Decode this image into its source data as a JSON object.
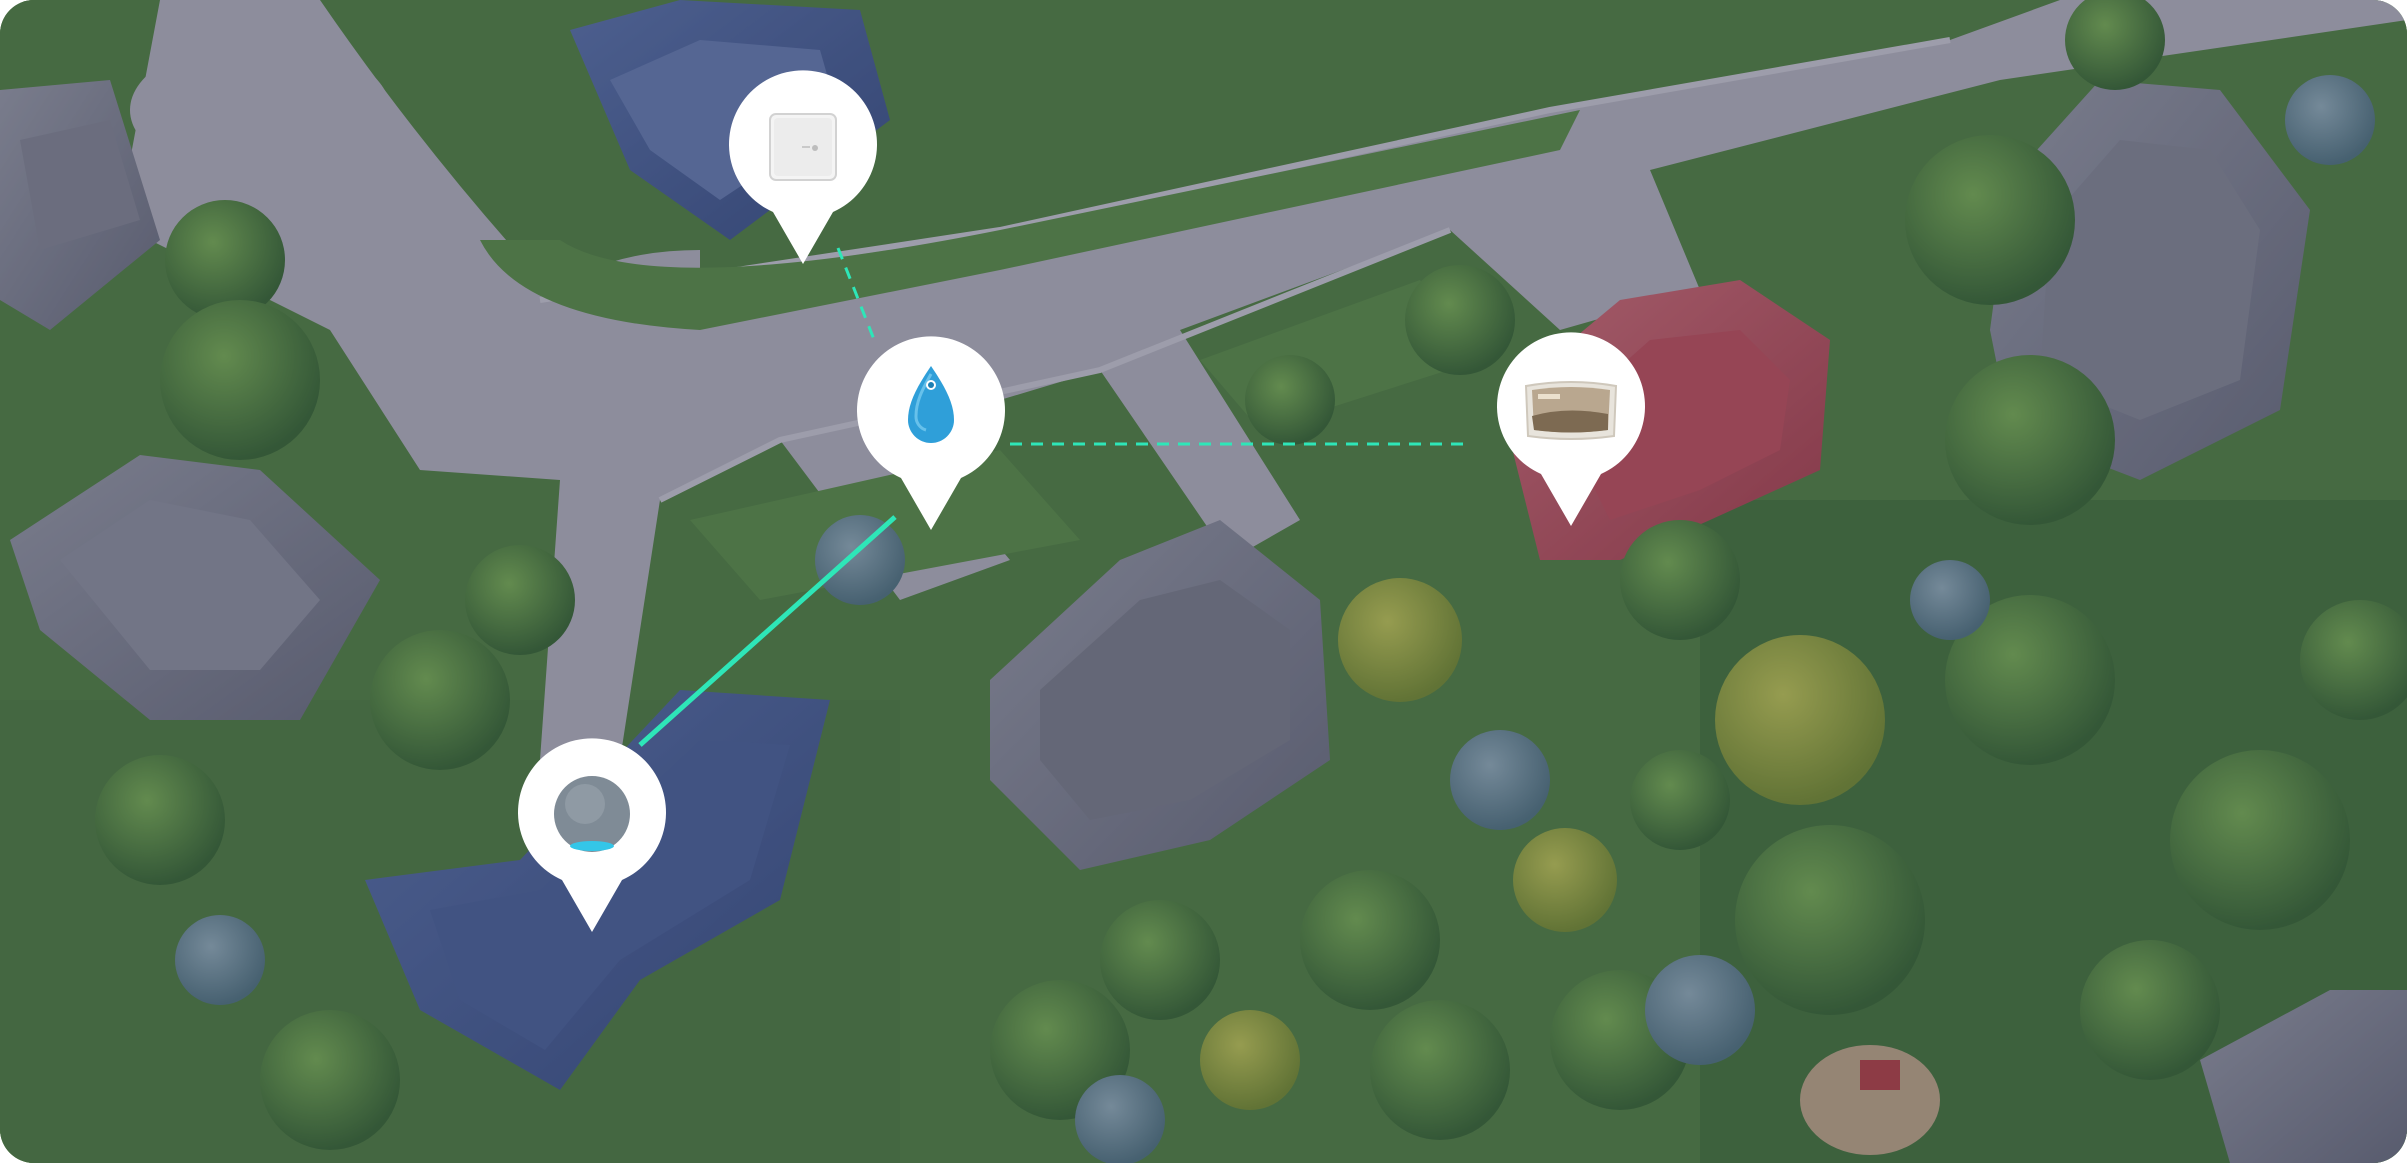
{
  "scene": {
    "description_hidden": "",
    "overlay_color": "#3b3d55",
    "connector_color": "#2ee6b8"
  },
  "pins": [
    {
      "device": "wifi-router",
      "icon": "router-icon"
    },
    {
      "device": "bluetooth-tracker-tag",
      "icon": "tracker-tag-icon"
    },
    {
      "device": "smart-display",
      "icon": "smart-display-icon"
    },
    {
      "device": "smart-speaker",
      "icon": "smart-speaker-icon"
    }
  ],
  "colors": {
    "pin_fill": "#ffffff",
    "tag_blue": "#2f9fd9",
    "speaker_gray": "#7f8b96",
    "speaker_ring": "#34c6e8",
    "display_screen": "#b9a78f"
  }
}
